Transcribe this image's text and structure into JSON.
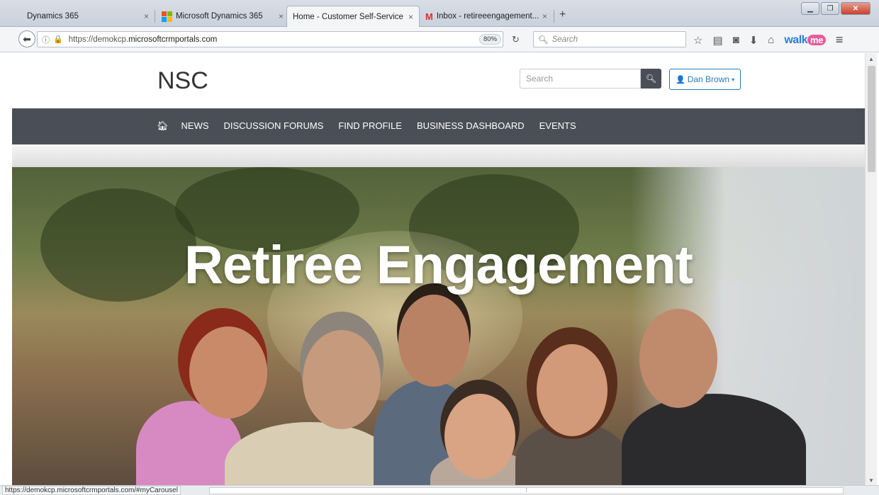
{
  "browser": {
    "tabs": [
      {
        "title": "Dynamics 365",
        "icon": "none"
      },
      {
        "title": "Microsoft Dynamics 365",
        "icon": "microsoft-logo-icon"
      },
      {
        "title": "Home - Customer Self-Service",
        "icon": "none",
        "active": true
      },
      {
        "title": "Inbox - retireeengagement...",
        "icon": "gmail-icon"
      }
    ],
    "close_glyph": "×",
    "new_tab_glyph": "+",
    "url_prefix": "https://demokcp.",
    "url_host": "microsoftcrmportals.com",
    "zoom": "80%",
    "search_placeholder": "Search",
    "walkme_text": "walk",
    "walkme_badge": "me",
    "status_url": "https://demokcp.microsoftcrmportals.com/#myCarousel"
  },
  "site": {
    "brand": "NSC",
    "search_placeholder": "Search",
    "user_name": "Dan Brown",
    "nav": [
      "NEWS",
      "DISCUSSION FORUMS",
      "FIND PROFILE",
      "BUSINESS DASHBOARD",
      "EVENTS"
    ],
    "hero_title": "Retiree Engagement"
  },
  "colors": {
    "nav_bg": "#4a4e57",
    "user_accent": "#2a7ab8"
  }
}
